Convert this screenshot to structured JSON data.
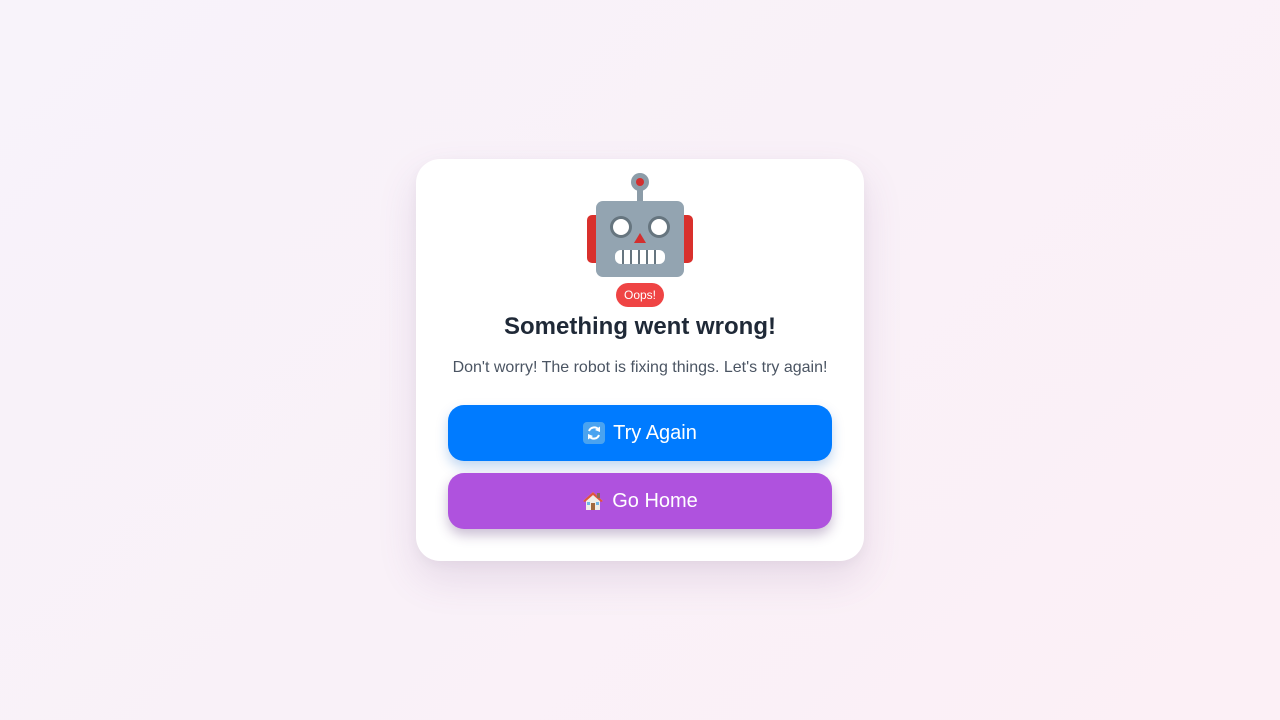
{
  "error_card": {
    "badge": "Oops!",
    "title": "Something went wrong!",
    "message": "Don't worry! The robot is fixing things. Let's try again!",
    "illustration": "robot-icon"
  },
  "actions": {
    "try_again": {
      "icon": "refresh-icon",
      "label": "Try Again"
    },
    "go_home": {
      "icon": "home-icon",
      "label": "Go Home"
    }
  },
  "colors": {
    "try_again_bg": "#007bff",
    "go_home_bg": "#af52de",
    "badge_bg": "#ef4444",
    "title": "#1f2937",
    "message": "#4b5563"
  }
}
